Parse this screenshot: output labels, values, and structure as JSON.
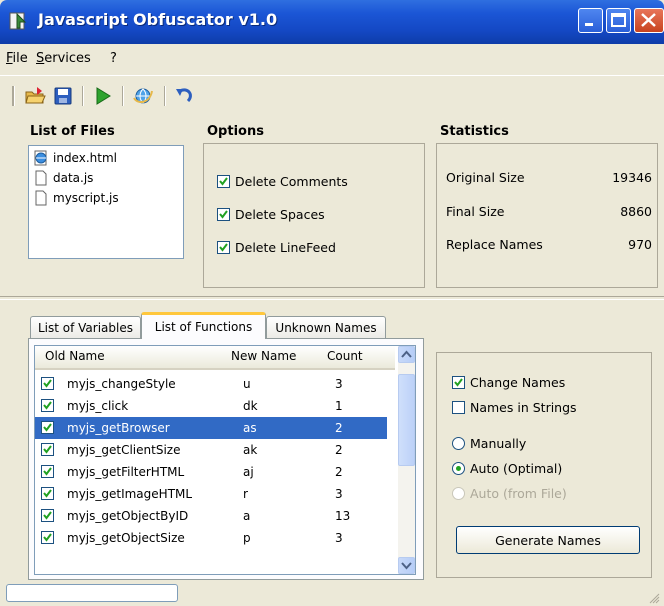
{
  "window": {
    "title": "Javascript Obfuscator v1.0"
  },
  "menu": [
    {
      "label": "File",
      "accel": "F",
      "rest": "ile"
    },
    {
      "label": "Services",
      "accel": "S",
      "rest": "ervices"
    },
    {
      "label": "?"
    }
  ],
  "toolbar": {
    "icons": [
      "open-folder-icon",
      "save-icon",
      "run-icon",
      "browser-icon",
      "undo-icon"
    ]
  },
  "files": {
    "heading": "List of Files",
    "items": [
      {
        "name": "index.html",
        "icon": "html-file-icon"
      },
      {
        "name": "data.js",
        "icon": "js-file-icon"
      },
      {
        "name": "myscript.js",
        "icon": "js-file-icon"
      }
    ]
  },
  "options": {
    "heading": "Options",
    "items": [
      {
        "label": "Delete Comments",
        "checked": true
      },
      {
        "label": "Delete Spaces",
        "checked": true
      },
      {
        "label": "Delete LineFeed",
        "checked": true
      }
    ]
  },
  "statistics": {
    "heading": "Statistics",
    "rows": [
      {
        "label": "Original Size",
        "value": "19346"
      },
      {
        "label": "Final Size",
        "value": "8860"
      },
      {
        "label": "Replace Names",
        "value": "970"
      }
    ]
  },
  "tabs": [
    {
      "label": "List of Variables",
      "active": false
    },
    {
      "label": "List of Functions",
      "active": true
    },
    {
      "label": "Unknown Names",
      "active": false
    }
  ],
  "functions_table": {
    "columns": [
      "Old Name",
      "New Name",
      "Count"
    ],
    "rows": [
      {
        "old": "myjs_changeStyle",
        "new": "u",
        "count": "3",
        "checked": true,
        "selected": false
      },
      {
        "old": "myjs_click",
        "new": "dk",
        "count": "1",
        "checked": true,
        "selected": false
      },
      {
        "old": "myjs_getBrowser",
        "new": "as",
        "count": "2",
        "checked": true,
        "selected": true
      },
      {
        "old": "myjs_getClientSize",
        "new": "ak",
        "count": "2",
        "checked": true,
        "selected": false
      },
      {
        "old": "myjs_getFilterHTML",
        "new": "aj",
        "count": "2",
        "checked": true,
        "selected": false
      },
      {
        "old": "myjs_getImageHTML",
        "new": "r",
        "count": "3",
        "checked": true,
        "selected": false
      },
      {
        "old": "myjs_getObjectByID",
        "new": "a",
        "count": "13",
        "checked": true,
        "selected": false
      },
      {
        "old": "myjs_getObjectSize",
        "new": "p",
        "count": "3",
        "checked": true,
        "selected": false
      }
    ]
  },
  "name_options": {
    "checkboxes": [
      {
        "label": "Change Names",
        "checked": true
      },
      {
        "label": "Names in Strings",
        "checked": false
      }
    ],
    "radios": [
      {
        "label": "Manually",
        "selected": false,
        "enabled": true
      },
      {
        "label": "Auto (Optimal)",
        "selected": true,
        "enabled": true
      },
      {
        "label": "Auto (from File)",
        "selected": false,
        "enabled": false
      }
    ],
    "generate_label": "Generate Names"
  },
  "colors": {
    "title_bar": "#1448c4",
    "selection": "#316ac5",
    "window_bg": "#ece9d8"
  }
}
